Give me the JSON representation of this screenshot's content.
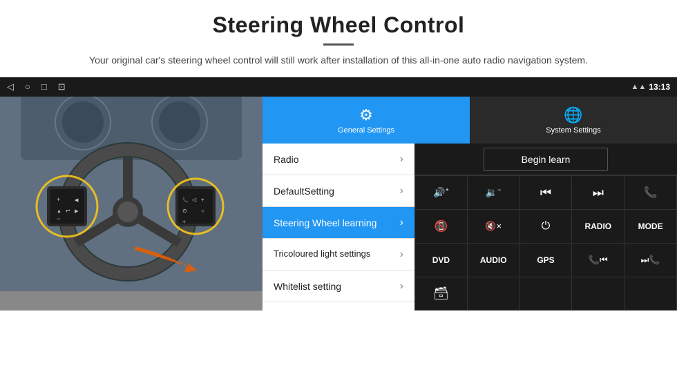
{
  "page": {
    "title": "Steering Wheel Control",
    "subtitle": "Your original car's steering wheel control will still work after installation of this all-in-one auto radio navigation system.",
    "divider": "—"
  },
  "android": {
    "time": "13:13",
    "nav_buttons": [
      "◁",
      "○",
      "□",
      "⊡"
    ]
  },
  "tabs": [
    {
      "id": "general",
      "label": "General Settings",
      "icon": "⚙",
      "active": true
    },
    {
      "id": "system",
      "label": "System Settings",
      "icon": "🌐",
      "active": false
    }
  ],
  "menu_items": [
    {
      "id": "radio",
      "label": "Radio",
      "active": false
    },
    {
      "id": "default",
      "label": "DefaultSetting",
      "active": false
    },
    {
      "id": "steering",
      "label": "Steering Wheel learning",
      "active": true
    },
    {
      "id": "tricoloured",
      "label": "Tricoloured light settings",
      "active": false
    },
    {
      "id": "whitelist",
      "label": "Whitelist setting",
      "active": false
    }
  ],
  "begin_learn": {
    "label": "Begin learn"
  },
  "control_buttons": [
    {
      "id": "vol-up",
      "symbol": "🔊+",
      "type": "icon"
    },
    {
      "id": "vol-down",
      "symbol": "🔉−",
      "type": "icon"
    },
    {
      "id": "prev-track",
      "symbol": "⏮",
      "type": "icon"
    },
    {
      "id": "next-track",
      "symbol": "⏭",
      "type": "icon"
    },
    {
      "id": "phone",
      "symbol": "📞",
      "type": "icon"
    },
    {
      "id": "hang-up",
      "symbol": "📵",
      "type": "icon"
    },
    {
      "id": "mute",
      "symbol": "🔇×",
      "type": "icon"
    },
    {
      "id": "power",
      "symbol": "⏻",
      "type": "icon"
    },
    {
      "id": "radio-btn",
      "label": "RADIO",
      "type": "text"
    },
    {
      "id": "mode-btn",
      "label": "MODE",
      "type": "text"
    },
    {
      "id": "dvd-btn",
      "label": "DVD",
      "type": "text"
    },
    {
      "id": "audio-btn",
      "label": "AUDIO",
      "type": "text"
    },
    {
      "id": "gps-btn",
      "label": "GPS",
      "type": "text"
    },
    {
      "id": "tel-prev",
      "symbol": "📞⏮",
      "type": "icon"
    },
    {
      "id": "tel-next",
      "symbol": "⏭📞",
      "type": "icon"
    },
    {
      "id": "scan-icon",
      "symbol": "🗃",
      "type": "icon"
    },
    {
      "id": "empty1",
      "label": "",
      "type": "empty"
    },
    {
      "id": "empty2",
      "label": "",
      "type": "empty"
    },
    {
      "id": "empty3",
      "label": "",
      "type": "empty"
    },
    {
      "id": "empty4",
      "label": "",
      "type": "empty"
    }
  ]
}
